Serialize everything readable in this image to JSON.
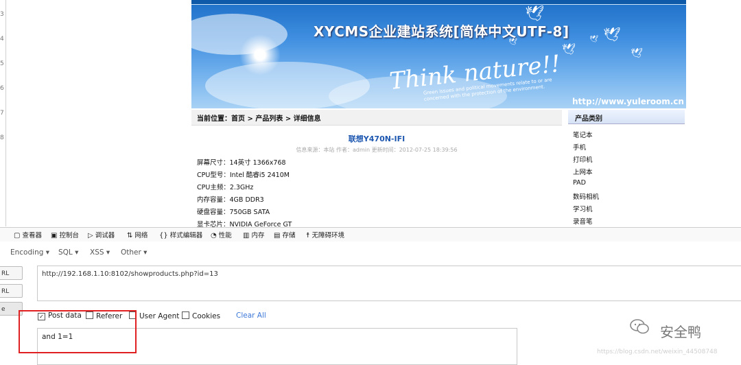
{
  "left_gutter": {
    "marks": [
      "3",
      "4",
      "5",
      "6",
      "7",
      "8"
    ]
  },
  "website": {
    "banner": {
      "title": "XYCMS企业建站系统[简体中文UTF-8]",
      "slogan": "Think nature!!",
      "tagline_line1": "Green issues and political movements relate to or are",
      "tagline_line2": "concerned with the protection of the environment.",
      "url": "http://www.yuleroom.cn"
    },
    "breadcrumb": "当前位置：首页 > 产品列表 > 详细信息",
    "product": {
      "title": "联想Y470N-IFI",
      "meta": "信息来源：本站  作者：admin  更新时间：2012-07-25 18:39:56",
      "specs": [
        "屏幕尺寸：14英寸  1366x768",
        "CPU型号：Intel 酷睿i5 2410M",
        "CPU主频：2.3GHz",
        "内存容量：4GB  DDR3",
        "硬盘容量：750GB  SATA",
        "显卡芯片：NVIDIA GeForce GT"
      ]
    },
    "category": {
      "header": "产品类别",
      "items": [
        "笔记本",
        "手机",
        "打印机",
        "上网本",
        "PAD",
        "数码相机",
        "学习机",
        "录音笔"
      ]
    }
  },
  "devtools": {
    "tabs": [
      {
        "label": "查看器",
        "icon": "inspector-icon"
      },
      {
        "label": "控制台",
        "icon": "console-icon"
      },
      {
        "label": "调试器",
        "icon": "debugger-icon"
      },
      {
        "label": "网络",
        "icon": "network-icon"
      },
      {
        "label": "样式编辑器",
        "icon": "style-editor-icon"
      },
      {
        "label": "性能",
        "icon": "performance-icon"
      },
      {
        "label": "内存",
        "icon": "memory-icon"
      },
      {
        "label": "存储",
        "icon": "storage-icon"
      },
      {
        "label": "无障碍环境",
        "icon": "accessibility-icon"
      }
    ]
  },
  "hackbar": {
    "menus": [
      "Encoding ▾",
      "SQL ▾",
      "XSS ▾",
      "Other ▾"
    ],
    "buttons": [
      "RL",
      "RL",
      "e"
    ],
    "url_value": "http://192.168.1.10:8102/showproducts.php?id=13",
    "options": [
      {
        "label": "Post data",
        "checked": true
      },
      {
        "label": "Referer",
        "checked": false
      },
      {
        "label": "User Agent",
        "checked": false
      },
      {
        "label": "Cookies",
        "checked": false
      }
    ],
    "clear_all": "Clear All",
    "post_value": "and 1=1"
  },
  "watermark": {
    "text": "安全鸭",
    "url": "https://blog.csdn.net/weixin_44508748"
  },
  "colors": {
    "link_blue": "#3b77d8",
    "highlight_red": "#e02020",
    "banner_blue": "#1d6fc7"
  }
}
